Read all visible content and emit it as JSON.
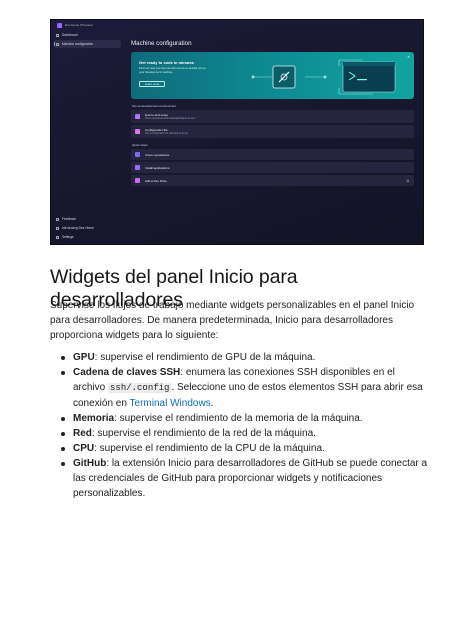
{
  "screenshot": {
    "app_title": "Dev Home (Preview)",
    "nav": [
      {
        "label": "Dashboard",
        "icon": "dashboard-icon"
      },
      {
        "label": "Machine configuration",
        "icon": "machine-config-icon",
        "active": true
      }
    ],
    "nav_bottom": [
      {
        "label": "Feedback",
        "icon": "feedback-icon"
      },
      {
        "label": "Introducing Dev Home",
        "icon": "info-icon"
      },
      {
        "label": "Settings",
        "icon": "settings-icon"
      }
    ],
    "page_title": "Machine configuration",
    "banner": {
      "title": "Get ready to code in minutes",
      "description": "Find out how you can use Dev Home to quickly set up your development machine",
      "link": "Learn more",
      "close": "✕"
    },
    "setup_section": "Set up development environment",
    "setup_rows": [
      {
        "title": "End-to-end setup",
        "subtitle": "Clone repositories and install applications at once"
      },
      {
        "title": "Configuration file",
        "subtitle": "Use a configuration file (WinGet) to set up"
      }
    ],
    "quick_section": "Quick steps",
    "quick_rows": [
      {
        "title": "Clone repositories"
      },
      {
        "title": "Install applications"
      },
      {
        "title": "Add a Dev Drive"
      }
    ],
    "colors": {
      "accent": "#7aa8ff",
      "banner": "#0e8b92",
      "row_bg": "#262540"
    }
  },
  "doc": {
    "heading": "Widgets del panel Inicio para desarrolladores",
    "intro": "Supervise los flujos de trabajo mediante widgets personalizables en el panel Inicio para desarrolladores. De manera predeterminada, Inicio para desarrolladores proporciona widgets para lo siguiente:",
    "items": [
      {
        "term": "GPU",
        "text": ": supervise el rendimiento de GPU de la máquina."
      },
      {
        "term": "Cadena de claves SSH",
        "text_before": ": enumera las conexiones SSH disponibles en el archivo ",
        "code": "ssh/.config",
        "text_mid": ". Seleccione uno de estos elementos SSH para abrir esa conexión en ",
        "link": "Terminal Windows",
        "text_after": "."
      },
      {
        "term": "Memoria",
        "text": ": supervise el rendimiento de la memoria de la máquina."
      },
      {
        "term": "Red",
        "text": ": supervise el rendimiento de la red de la máquina."
      },
      {
        "term": "CPU",
        "text": ": supervise el rendimiento de la CPU de la máquina."
      },
      {
        "term": "GitHub",
        "text": ": la extensión Inicio para desarrolladores de GitHub se puede conectar a las credenciales de GitHub para proporcionar widgets y notificaciones personalizables."
      }
    ]
  }
}
